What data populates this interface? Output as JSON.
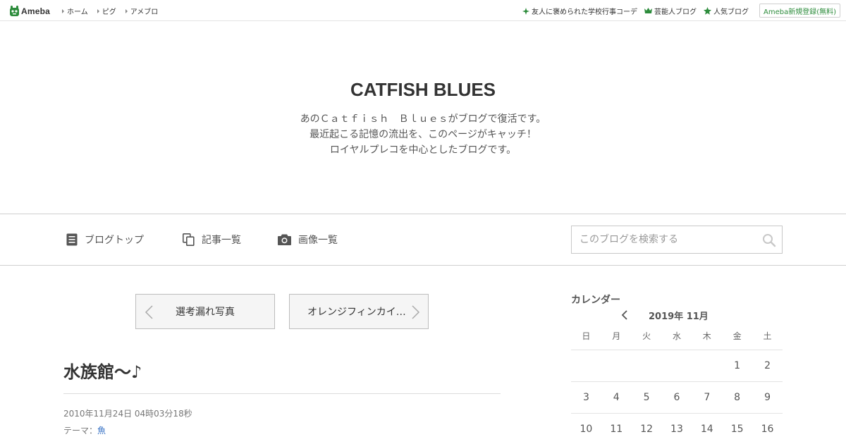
{
  "topbar": {
    "logo_text": "Ameba",
    "nav": [
      "ホーム",
      "ピグ",
      "アメブロ"
    ],
    "right_links": [
      {
        "icon": "sparkle-icon",
        "label": "友人に褒められた学校行事コーデ"
      },
      {
        "icon": "crown-icon",
        "label": "芸能人ブログ"
      },
      {
        "icon": "star-icon",
        "label": "人気ブログ"
      }
    ],
    "signup_label": "Ameba新規登録(無料)"
  },
  "header": {
    "title": "CATFISH BLUES",
    "description": [
      "あのＣａｔｆｉｓｈ　Ｂｌｕｅｓがブログで復活です。",
      "最近起こる記憶の流出を、このページがキャッチ！",
      "ロイヤルプレコを中心としたブログです。"
    ]
  },
  "nav": {
    "blog_top": "ブログトップ",
    "entry_list": "記事一覧",
    "image_list": "画像一覧",
    "search_placeholder": "このブログを検索する"
  },
  "pager": {
    "prev_label": "選考漏れ写真",
    "next_label": "オレンジフィンカイ…"
  },
  "article": {
    "title": "水族館～♪",
    "date": "2010年11月24日 04時03分18秒",
    "theme_prefix": "テーマ：",
    "theme": "魚"
  },
  "calendar": {
    "heading": "カレンダー",
    "month": "2019年 11月",
    "weekdays": [
      "日",
      "月",
      "火",
      "水",
      "木",
      "金",
      "土"
    ],
    "weeks": [
      [
        "",
        "",
        "",
        "",
        "",
        "1",
        "2"
      ],
      [
        "3",
        "4",
        "5",
        "6",
        "7",
        "8",
        "9"
      ],
      [
        "10",
        "11",
        "12",
        "13",
        "14",
        "15",
        "16"
      ]
    ]
  },
  "colors": {
    "accent_green": "#2d8c3c",
    "link_blue": "#3570c4",
    "text": "#333333",
    "border": "#cfcfcf"
  }
}
